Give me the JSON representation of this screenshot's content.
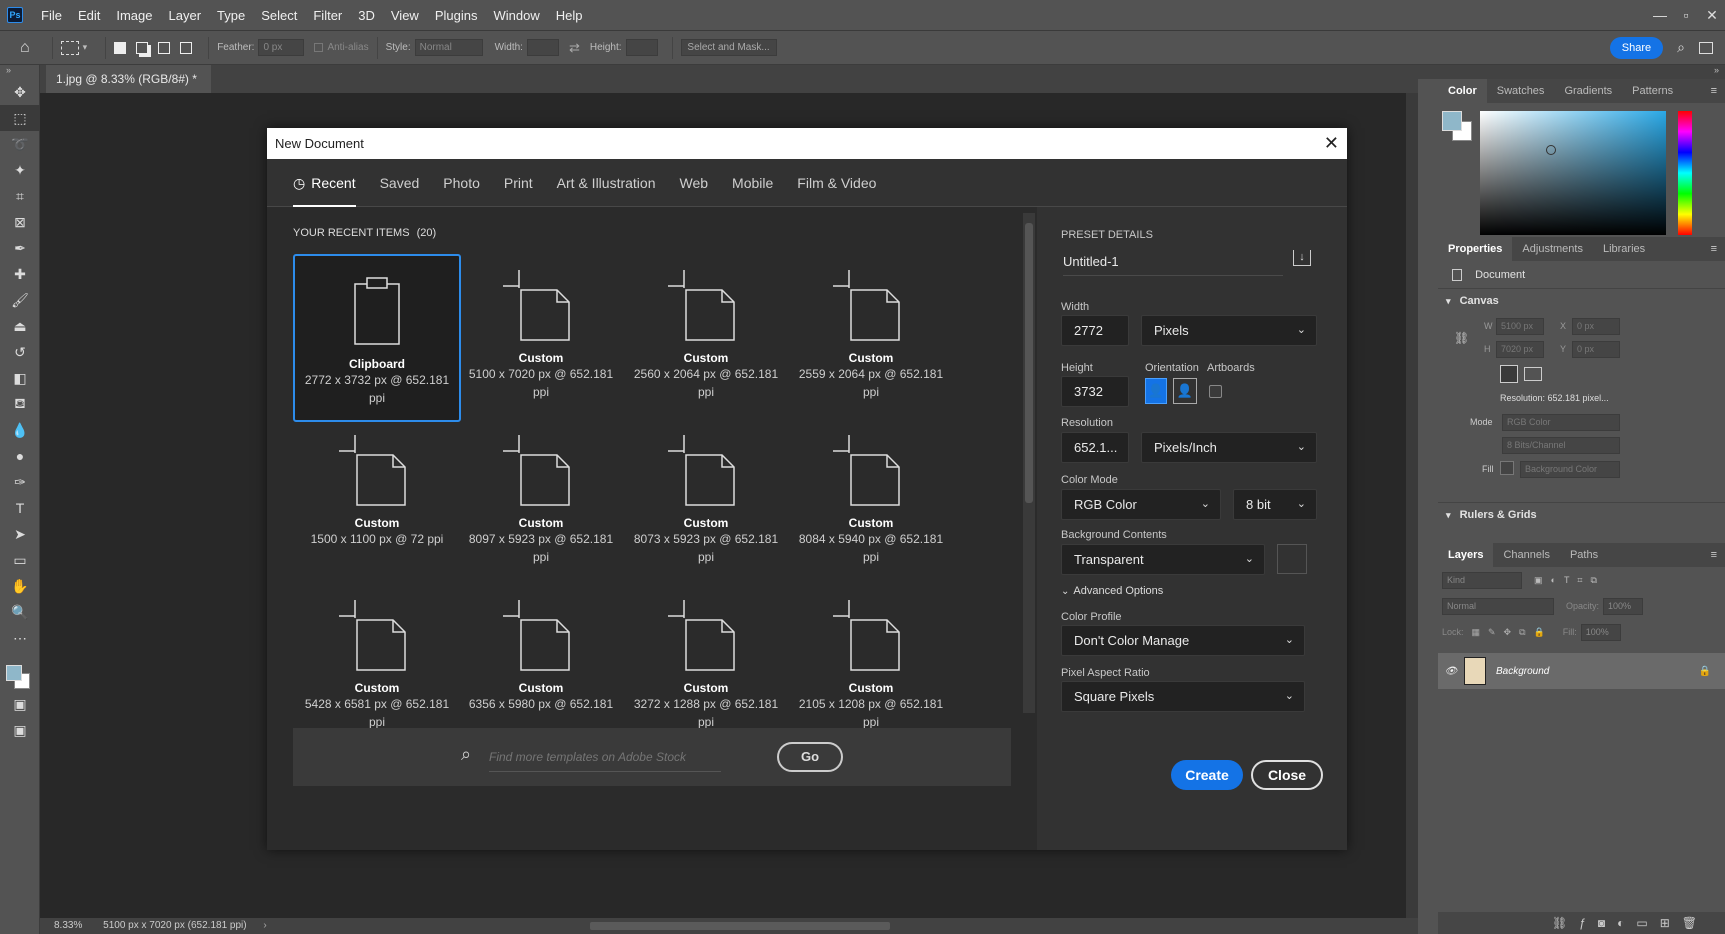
{
  "menubar": {
    "logo": "Ps",
    "items": [
      "File",
      "Edit",
      "Image",
      "Layer",
      "Type",
      "Select",
      "Filter",
      "3D",
      "View",
      "Plugins",
      "Window",
      "Help"
    ]
  },
  "options": {
    "feather_label": "Feather:",
    "feather_value": "0 px",
    "antialias_label": "Anti-alias",
    "style_label": "Style:",
    "style_value": "Normal",
    "width_label": "Width:",
    "height_label": "Height:",
    "select_mask": "Select and Mask...",
    "share": "Share"
  },
  "document_tab": "1.jpg @ 8.33% (RGB/8#) *",
  "status": {
    "zoom": "8.33%",
    "info": "5100 px x 7020 px (652.181 ppi)"
  },
  "color_panel": {
    "tabs": [
      "Color",
      "Swatches",
      "Gradients",
      "Patterns"
    ],
    "fg_color": "#8fb7c9"
  },
  "properties_panel": {
    "tabs": [
      "Properties",
      "Adjustments",
      "Libraries"
    ],
    "doc_label": "Document",
    "canvas_title": "Canvas",
    "w_label": "W",
    "w_value": "5100 px",
    "h_label": "H",
    "h_value": "7020 px",
    "x_label": "X",
    "x_value": "0 px",
    "y_label": "Y",
    "y_value": "0 px",
    "resolution": "Resolution:  652.181  pixel...",
    "mode_label": "Mode",
    "mode_value": "RGB Color",
    "depth_value": "8 Bits/Channel",
    "fill_label": "Fill",
    "fill_value": "Background Color",
    "rulers_title": "Rulers & Grids"
  },
  "layers_panel": {
    "tabs": [
      "Layers",
      "Channels",
      "Paths"
    ],
    "kind_placeholder": "Kind",
    "blend": "Normal",
    "opacity_label": "Opacity:",
    "opacity_value": "100%",
    "lock_label": "Lock:",
    "fill_label": "Fill:",
    "fill_value": "100%",
    "layer_name": "Background"
  },
  "dialog": {
    "title": "New Document",
    "tabs": [
      "Recent",
      "Saved",
      "Photo",
      "Print",
      "Art & Illustration",
      "Web",
      "Mobile",
      "Film & Video"
    ],
    "recent_heading": "YOUR RECENT ITEMS",
    "recent_count": "(20)",
    "items": [
      {
        "name": "Clipboard",
        "desc": "2772 x 3732 px @ 652.181 ppi"
      },
      {
        "name": "Custom",
        "desc": "5100 x 7020 px @ 652.181 ppi"
      },
      {
        "name": "Custom",
        "desc": "2560 x 2064 px @ 652.181 ppi"
      },
      {
        "name": "Custom",
        "desc": "2559 x 2064 px @ 652.181 ppi"
      },
      {
        "name": "Custom",
        "desc": "1500 x 1100 px @ 72 ppi"
      },
      {
        "name": "Custom",
        "desc": "8097 x 5923 px @ 652.181 ppi"
      },
      {
        "name": "Custom",
        "desc": "8073 x 5923 px @ 652.181 ppi"
      },
      {
        "name": "Custom",
        "desc": "8084 x 5940 px @ 652.181 ppi"
      },
      {
        "name": "Custom",
        "desc": "5428 x 6581 px @ 652.181 ppi"
      },
      {
        "name": "Custom",
        "desc": "6356 x 5980 px @ 652.181"
      },
      {
        "name": "Custom",
        "desc": "3272 x 1288 px @ 652.181 ppi"
      },
      {
        "name": "Custom",
        "desc": "2105 x 1208 px @ 652.181 ppi"
      }
    ],
    "search_placeholder": "Find more templates on Adobe Stock",
    "go": "Go",
    "preset": {
      "heading": "PRESET DETAILS",
      "name": "Untitled-1",
      "width_label": "Width",
      "width": "2772",
      "width_unit": "Pixels",
      "height_label": "Height",
      "height": "3732",
      "orientation_label": "Orientation",
      "artboards_label": "Artboards",
      "resolution_label": "Resolution",
      "resolution": "652.1...",
      "resolution_unit": "Pixels/Inch",
      "color_mode_label": "Color Mode",
      "color_mode": "RGB Color",
      "bit_depth": "8 bit",
      "bg_label": "Background Contents",
      "bg_value": "Transparent",
      "advanced": "Advanced Options",
      "profile_label": "Color Profile",
      "profile": "Don't Color Manage",
      "aspect_label": "Pixel Aspect Ratio",
      "aspect": "Square Pixels"
    },
    "create": "Create",
    "close": "Close"
  }
}
